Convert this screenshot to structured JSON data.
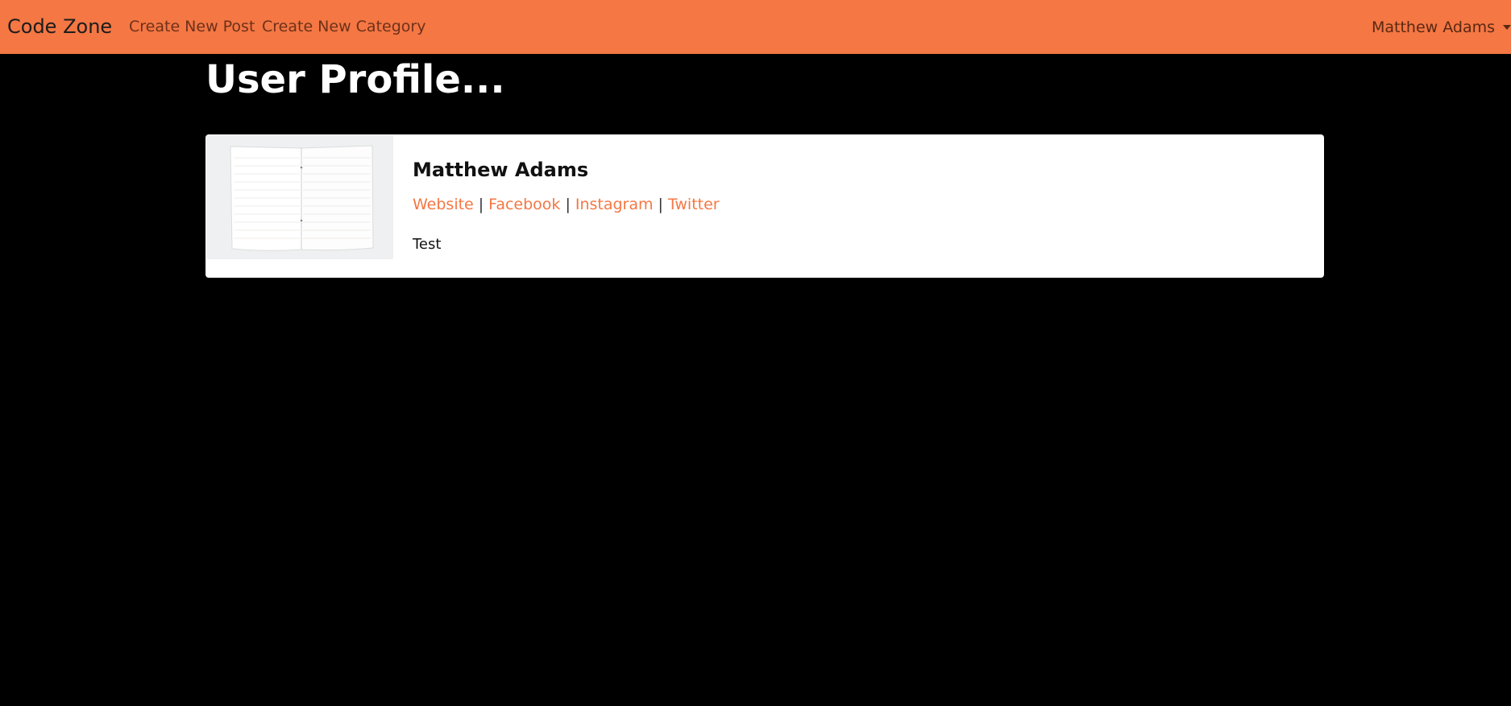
{
  "navbar": {
    "brand": "Code Zone",
    "links": [
      "Create New Post",
      "Create New Category"
    ],
    "user": "Matthew Adams",
    "background": "#f47744"
  },
  "page": {
    "title": "User Profile..."
  },
  "profile": {
    "name": "Matthew Adams",
    "links": [
      "Website",
      "Facebook",
      "Instagram",
      "Twitter"
    ],
    "separator": "|",
    "bio": "Test",
    "image_icon": "open-notebook-photo",
    "link_color": "#f47744"
  }
}
